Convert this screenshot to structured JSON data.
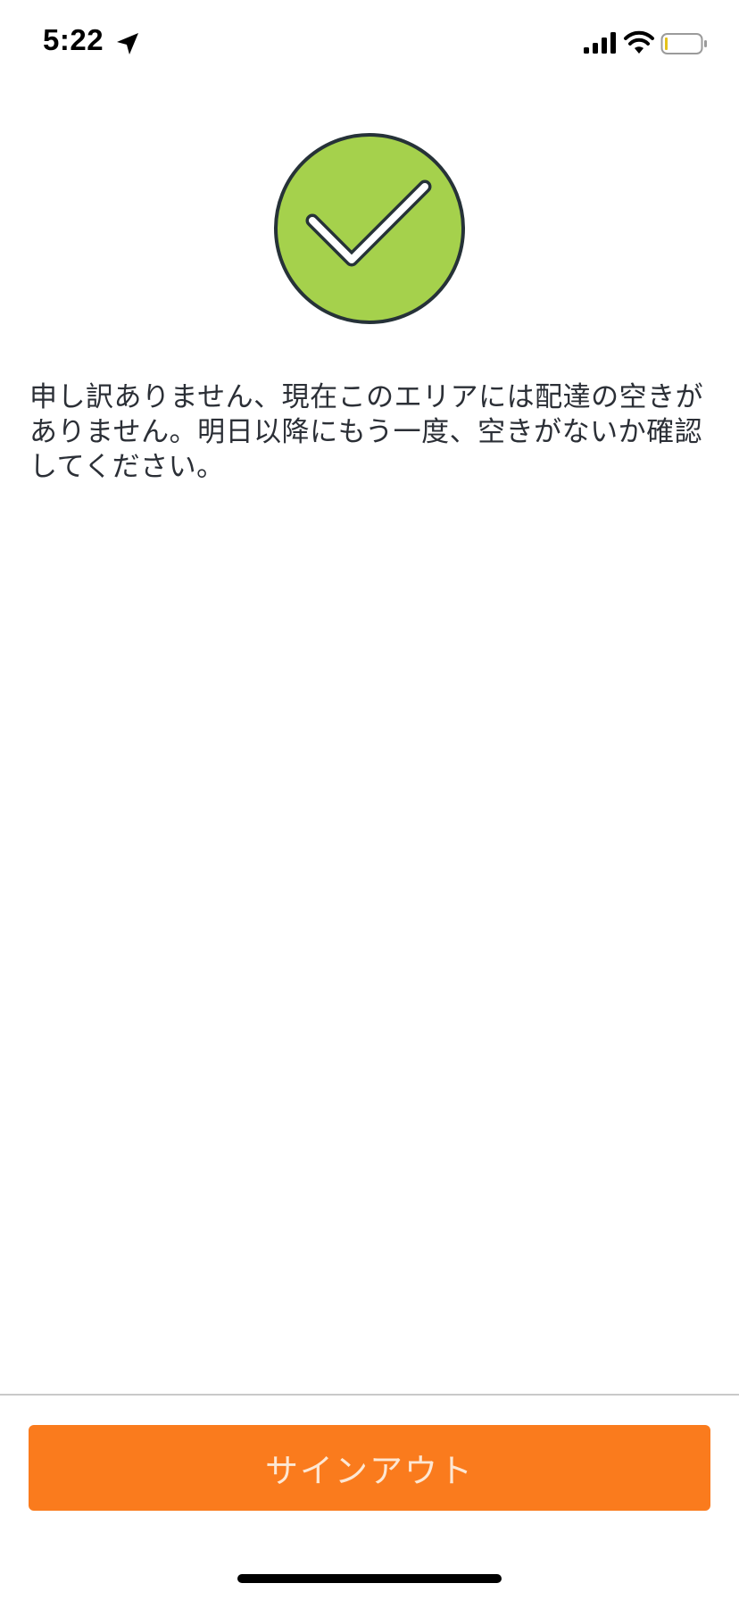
{
  "status_bar": {
    "time": "5:22",
    "icons": [
      "location-arrow-icon",
      "cellular-signal-icon",
      "wifi-icon",
      "battery-icon"
    ]
  },
  "badge": {
    "icon": "checkmark-icon",
    "fill_color": "#a5d14c",
    "stroke_color": "#263238"
  },
  "message": {
    "text": "申し訳ありません、現在このエリアには配達の空きがありません。明日以降にもう一度、空きがないか確認してください。"
  },
  "footer": {
    "signout_label": "サインアウト",
    "button_color": "#fa7b1d"
  }
}
